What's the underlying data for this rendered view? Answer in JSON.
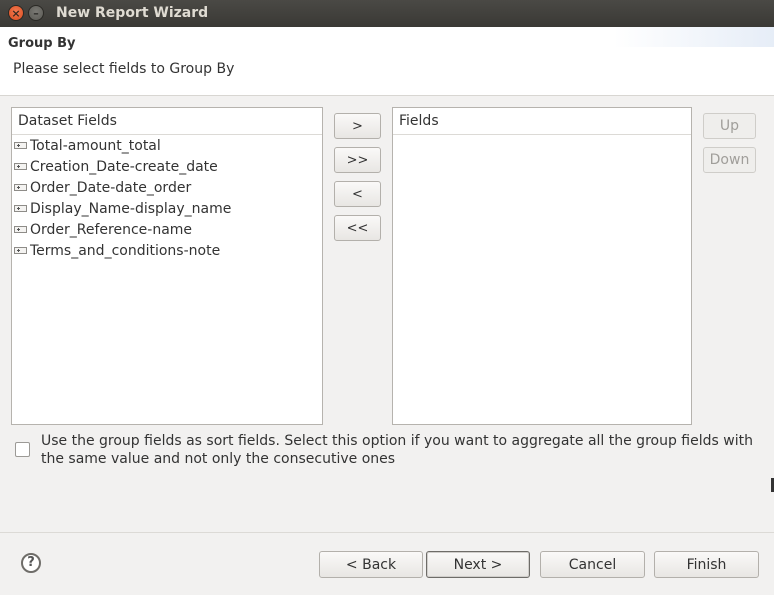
{
  "window": {
    "title": "New Report Wizard",
    "close_glyph": "×",
    "minimize_glyph": "–"
  },
  "header": {
    "title": "Group By",
    "subtitle": "Please select fields to Group By"
  },
  "dataset_fields": {
    "header": "Dataset Fields",
    "items": [
      "Total-amount_total",
      "Creation_Date-create_date",
      "Order_Date-date_order",
      "Display_Name-display_name",
      "Order_Reference-name",
      "Terms_and_conditions-note"
    ]
  },
  "fields": {
    "header": "Fields",
    "items": []
  },
  "transfer_buttons": {
    "add": ">",
    "add_all": ">>",
    "remove": "<",
    "remove_all": "<<"
  },
  "order_buttons": {
    "up": "Up",
    "down": "Down"
  },
  "sort_option": {
    "checked": false,
    "label": "Use the group fields as sort fields. Select this option if you want to aggregate all the group fields with the same value and not only the consecutive ones"
  },
  "footer": {
    "help_glyph": "?",
    "back": "< Back",
    "next": "Next >",
    "cancel": "Cancel",
    "finish": "Finish"
  }
}
